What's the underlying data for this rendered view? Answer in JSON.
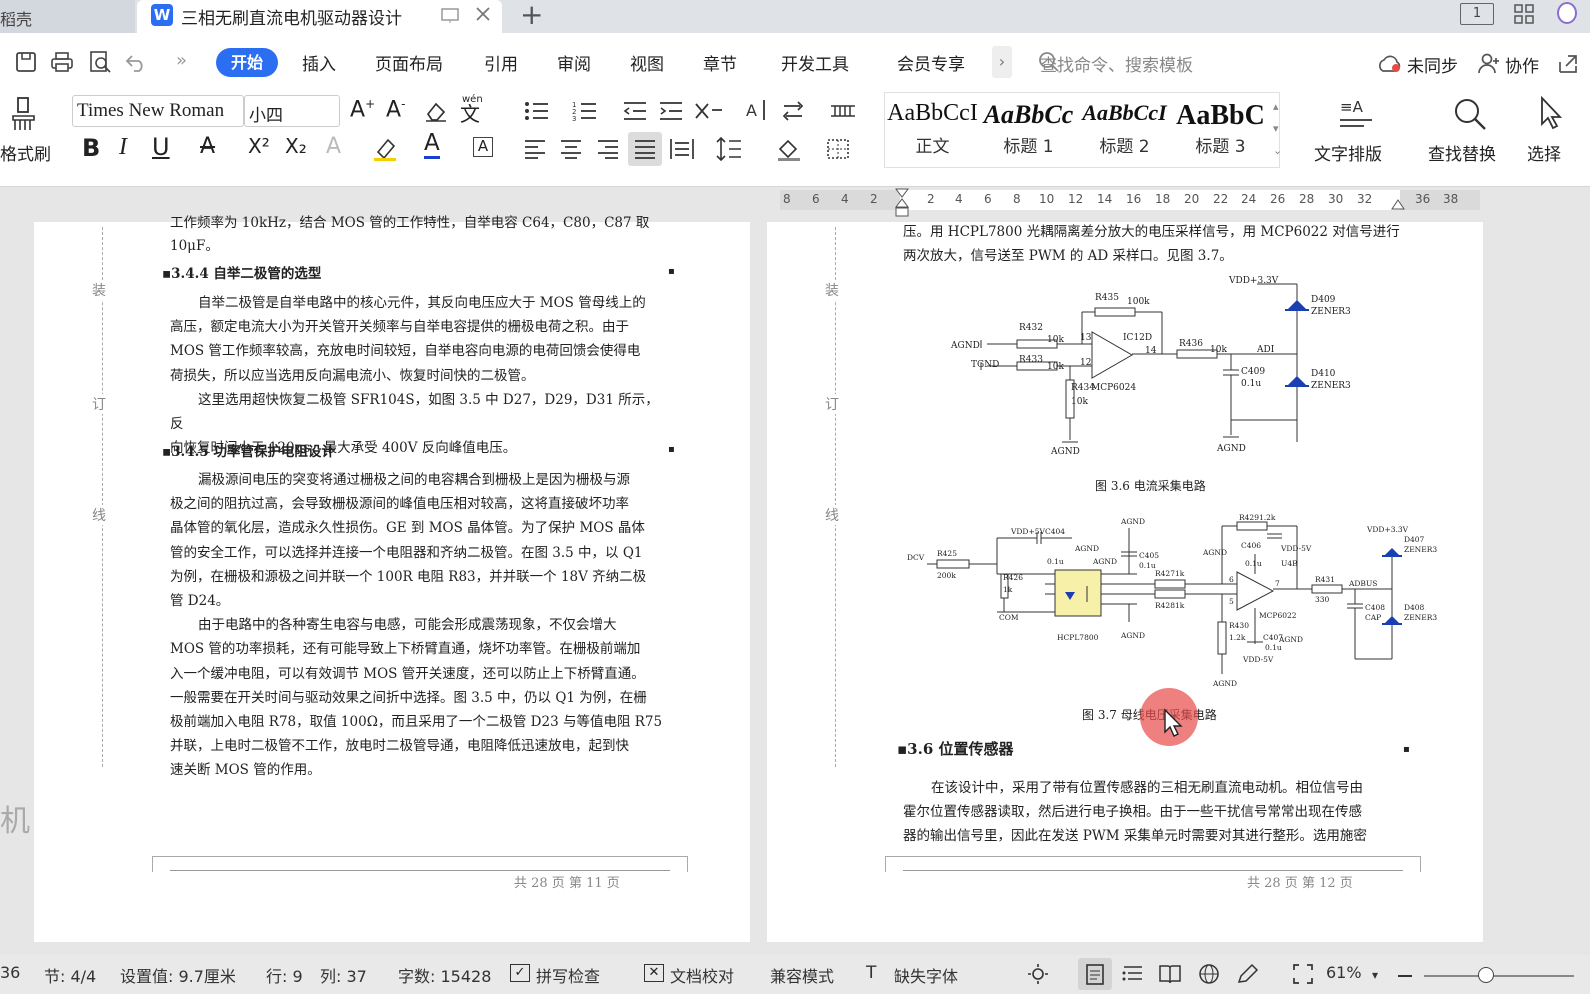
{
  "tabs": {
    "home_label": "稻壳",
    "doc_icon": "W",
    "doc_title": "三相无刷直流电机驱动器设计",
    "add_label": "+"
  },
  "window": {
    "layout_label": "1"
  },
  "menu": {
    "start": "开始",
    "items": [
      "插入",
      "页面布局",
      "引用",
      "审阅",
      "视图",
      "章节",
      "开发工具",
      "会员专享"
    ],
    "search": "查找命令、搜索模板",
    "sync": "未同步",
    "collab": "协作"
  },
  "toolbar": {
    "format_brush": "格式刷",
    "font_name": "Times New Roman",
    "font_size": "小四",
    "styles": [
      {
        "preview": "AaBbCcI",
        "label": "正文"
      },
      {
        "preview": "AaBbCc",
        "label": "标题 1"
      },
      {
        "preview": "AaBbCcI",
        "label": "标题 2"
      },
      {
        "preview": "AaBbC",
        "label": "标题 3"
      }
    ],
    "text_layout": "文字排版",
    "find_replace": "查找替换",
    "select": "选择",
    "bold": "B",
    "italic": "I",
    "underline": "U",
    "superscript": "X²",
    "subscript": "X₂",
    "phonetic": "wén"
  },
  "ruler": {
    "numbers": [
      "8",
      "6",
      "4",
      "2",
      "2",
      "4",
      "6",
      "8",
      "10",
      "12",
      "14",
      "16",
      "18",
      "20",
      "22",
      "24",
      "26",
      "28",
      "30",
      "32",
      "36",
      "38"
    ]
  },
  "left_page": {
    "binding": [
      "装",
      "订",
      "线"
    ],
    "top_line1": "工作频率为 10kHz，结合 MOS 管的工作特性，自举电容 C64，C80，C87 取",
    "top_line2": "10μF。",
    "heading1": "3.4.4 自举二极管的选型",
    "para1": [
      "自举二极管是自举电路中的核心元件，其反向电压应大于 MOS 管母线上的",
      "高压，额定电流大小为开关管开关频率与自举电容提供的栅极电荷之积。由于",
      "MOS 管工作频率较高，充放电时间较短，自举电容向电源的电荷回馈会使得电",
      "荷损失，所以应当选用反向漏电流小、恢复时间快的二极管。"
    ],
    "para2": [
      "这里选用超快恢复二极管 SFR104S，如图 3.5 中 D27，D29，D31 所示，反",
      "向恢复时间小于 120ns，最大承受 400V 反向峰值电压。"
    ],
    "heading2": "3.4.5 功率管保护电阻设计",
    "para3": [
      "漏极源间电压的突变将通过栅极之间的电容耦合到栅极上是因为栅极与源",
      "极之间的阻抗过高，会导致栅极源间的峰值电压相对较高，这将直接破坏功率",
      "晶体管的氧化层，造成永久性损伤。GE 到 MOS 晶体管。为了保护 MOS 晶体",
      "管的安全工作，可以选择并连接一个电阻器和齐纳二极管。在图 3.5 中，以 Q1",
      "为例，在栅极和源极之间并联一个 100R 电阻 R83，并并联一个 18V 齐纳二极",
      "管 D24。"
    ],
    "para4": [
      "由于电路中的各种寄生电容与电感，可能会形成震荡现象，不仅会增大",
      "MOS 管的功率损耗，还有可能导致上下桥臂直通，烧坏功率管。在栅极前端加",
      "入一个缓冲电阻，可以有效调节 MOS 管开关速度，还可以防止上下桥臂直通。",
      "一般需要在开关时间与驱动效果之间折中选择。图 3.5 中，仍以 Q1 为例，在栅",
      "极前端加入电阻 R78，取值 100Ω，而且采用了一个二极管 D23 与等值电阻 R75",
      "并联，上电时二极管不工作，放电时二极管导通，电阻降低迅速放电，起到快",
      "速关断 MOS 管的作用。"
    ],
    "footer": "共 28 页 第 11 页"
  },
  "right_page": {
    "binding": [
      "装",
      "订",
      "线"
    ],
    "top_line1": "压。用 HCPL7800 光耦隔离差分放大的电压采样信号，用 MCP6022 对信号进行",
    "top_line2": "两次放大，信号送至 PWM 的 AD 采样口。见图 3.7。",
    "fig1": {
      "caption": "图 3.6 电流采集电路",
      "labels": {
        "vdd": "VDD+3.3V",
        "r435": "R435",
        "r435v": "100k",
        "d409": "D409",
        "z1": "ZENER3",
        "r432": "R432",
        "agnd_in": "AGND",
        "tgnd": "TGND",
        "r433": "R433",
        "r432v": "10k",
        "r433v": "10k",
        "ic": "IC12D",
        "p13": "13",
        "p12": "12",
        "p14": "14",
        "r436": "R436",
        "r436v": "10k",
        "adi": "ADI",
        "r434": "R434",
        "r434v": "10k",
        "mcp": "MCP6024",
        "c409": "C409",
        "c409v": "0.1u",
        "d410": "D410",
        "z2": "ZENER3",
        "agnd1": "AGND",
        "agnd2": "AGND"
      }
    },
    "fig2": {
      "caption": "图 3.7 母线电压采集电路",
      "labels": {
        "dcv": "DCV",
        "r425": "R425",
        "r425v": "200k",
        "vdd5": "VDD+5V",
        "c404": "C404",
        "c404v": "0.1u",
        "agnd_a": "AGND",
        "agnd_top": "AGND",
        "c405": "C405",
        "c405v": "0.1u",
        "r426": "R426",
        "r426v": "1k",
        "com": "COM",
        "hcpl": "HCPL7800",
        "r427": "R427",
        "r427v": "1k",
        "r428": "R428",
        "r428v": "1k",
        "r429": "R429",
        "r429v": "1.2k",
        "c406": "C406",
        "c406v": "0.1u",
        "vdd5b": "VDD-5V",
        "u4b": "U4B",
        "mcp6022": "MCP6022",
        "r430": "R430",
        "r430v": "1.2k",
        "c407": "C407",
        "c407v": "0.1u",
        "vdd_m5": "VDD-5V",
        "r431": "R431",
        "r431v": "330",
        "adbus": "ADBUS",
        "c408": "C408",
        "c408v": "CAP",
        "d407": "D407",
        "d408": "D408",
        "z3": "ZENER3",
        "z4": "ZENER3",
        "vdd33": "VDD+3.3V",
        "agnd_b": "AGND",
        "agnd_c": "AGND",
        "agnd_d": "AGND",
        "agnd_e": "AGND",
        "agnd_f": "AGND",
        "p7": "7",
        "p6": "6",
        "p5": "5"
      }
    },
    "heading": "3.6 位置传感器",
    "para": [
      "在该设计中，采用了带有位置传感器的三相无刷直流电动机。相位信号由",
      "霍尔位置传感器读取，然后进行电子换相。由于一些干扰信号常常出现在传感",
      "器的输出信号里，因此在发送 PWM 采集单元时需要对其进行整形。选用施密"
    ],
    "footer": "共 28 页 第 12 页"
  },
  "status": {
    "page": "36",
    "section": "节: 4/4",
    "setting": "设置值: 9.7厘米",
    "row": "行: 9",
    "col": "列: 37",
    "wordcount": "字数: 15428",
    "spellcheck": "拼写检查",
    "doccheck": "文档校对",
    "compat": "兼容模式",
    "missing_font": "缺失字体",
    "zoom": "61%"
  },
  "colors": {
    "accent": "#2b6ef2",
    "page_bg": "#e6e6e6",
    "cursor_highlight": "#e84a4a",
    "zener": "#1a3fb0",
    "optocoupler": "#f6f0a8"
  }
}
